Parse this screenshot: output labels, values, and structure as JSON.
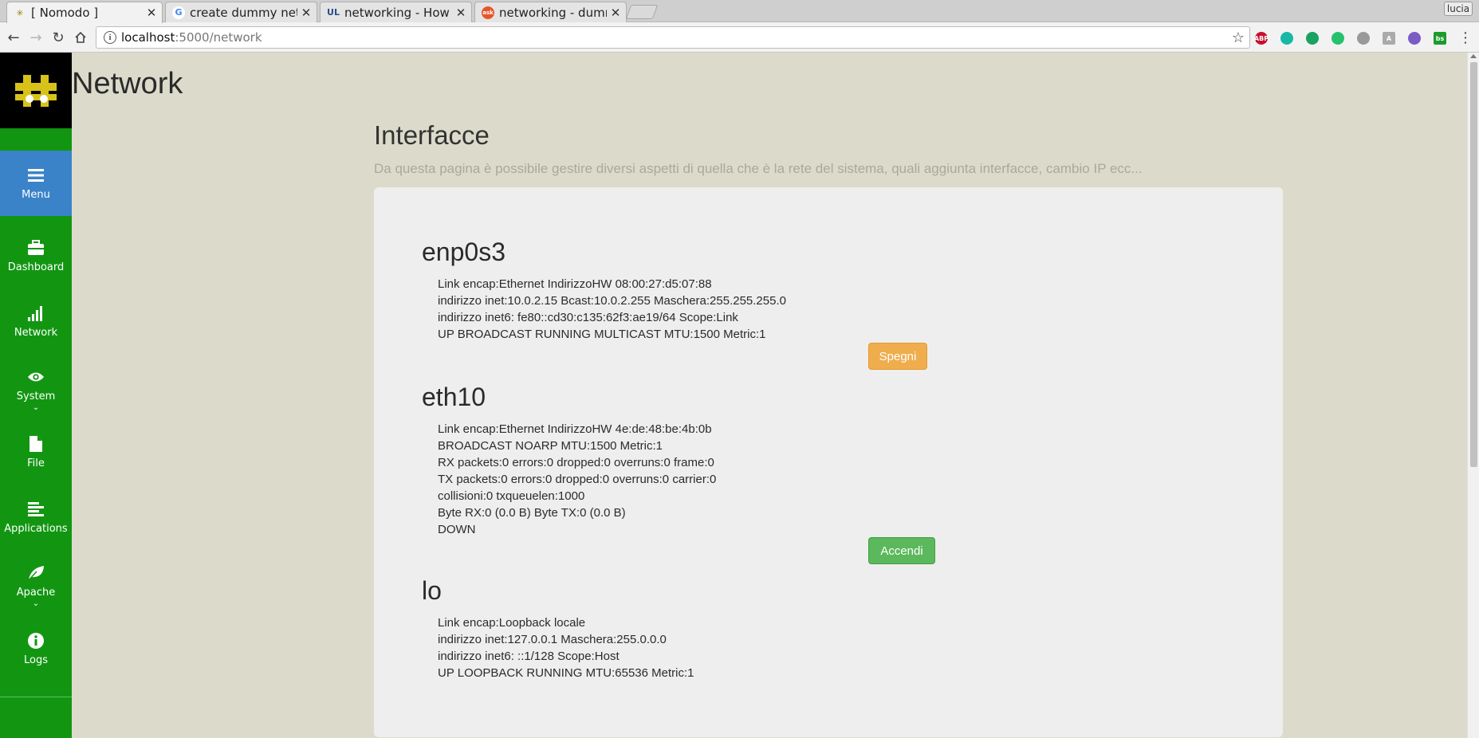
{
  "browser": {
    "tabs": [
      {
        "title": "[ Nomodo ]",
        "favicon": "nomodo-logo"
      },
      {
        "title": "create dummy netw",
        "favicon": "google-g"
      },
      {
        "title": "networking - How c",
        "favicon": "ubuntu-ul"
      },
      {
        "title": "networking - dumm",
        "favicon": "askubuntu"
      }
    ],
    "profile_name": "lucia",
    "address": {
      "host": "localhost",
      "path": ":5000/network"
    },
    "extensions": [
      "abp-icon",
      "extension-teal-icon",
      "extension-green-icon",
      "chat-icon",
      "globe-icon",
      "a-icon",
      "extension-purple-icon",
      "bs-icon"
    ],
    "extension_labels": {
      "abp": "ABP",
      "a": "A",
      "bs": "bs"
    }
  },
  "sidebar": {
    "items": [
      {
        "label": "Menu",
        "icon": "bars-icon"
      },
      {
        "label": "Dashboard",
        "icon": "briefcase-icon"
      },
      {
        "label": "Network",
        "icon": "signal-icon"
      },
      {
        "label": "System",
        "icon": "eye-icon",
        "has_caret": true
      },
      {
        "label": "File",
        "icon": "file-icon"
      },
      {
        "label": "Applications",
        "icon": "list-icon"
      },
      {
        "label": "Apache",
        "icon": "leaf-icon",
        "has_caret": true
      },
      {
        "label": "Logs",
        "icon": "info-icon"
      }
    ],
    "caret": "⌄"
  },
  "page": {
    "title": "Network",
    "section_title": "Interfacce",
    "section_description": "Da questa pagina è possibile gestire diversi aspetti di quella che è la rete del sistema, quali aggiunta interfacce, cambio IP ecc..."
  },
  "interfaces": [
    {
      "name": "enp0s3",
      "lines": [
        "Link encap:Ethernet IndirizzoHW 08:00:27:d5:07:88",
        "indirizzo inet:10.0.2.15 Bcast:10.0.2.255 Maschera:255.255.255.0",
        "indirizzo inet6: fe80::cd30:c135:62f3:ae19/64 Scope:Link",
        "UP BROADCAST RUNNING MULTICAST MTU:1500 Metric:1"
      ],
      "button": "Spegni"
    },
    {
      "name": "eth10",
      "lines": [
        "Link encap:Ethernet IndirizzoHW 4e:de:48:be:4b:0b",
        "BROADCAST NOARP MTU:1500 Metric:1",
        "RX packets:0 errors:0 dropped:0 overruns:0 frame:0",
        "TX packets:0 errors:0 dropped:0 overruns:0 carrier:0",
        "collisioni:0 txqueuelen:1000",
        "Byte RX:0 (0.0 B) Byte TX:0 (0.0 B)",
        "DOWN"
      ],
      "button": "Accendi"
    },
    {
      "name": "lo",
      "lines": [
        "Link encap:Loopback locale",
        "indirizzo inet:127.0.0.1 Maschera:255.0.0.0",
        "indirizzo inet6: ::1/128 Scope:Host",
        "UP LOOPBACK RUNNING MTU:65536 Metric:1"
      ]
    }
  ],
  "colors": {
    "sidebar": "#129612",
    "sidebar_active": "#3a83c9",
    "page_bg": "#dcdbcb",
    "panel_bg": "#eeeeee",
    "warning": "#f0ad4e",
    "success": "#5cb85c"
  }
}
